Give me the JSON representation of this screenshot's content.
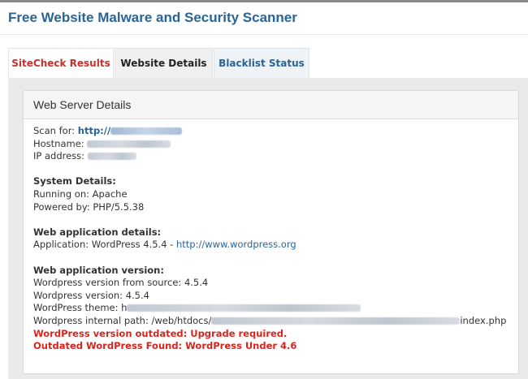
{
  "header": {
    "title": "Free Website Malware and Security Scanner"
  },
  "tabs": [
    {
      "label": "SiteCheck Results"
    },
    {
      "label": "Website Details"
    },
    {
      "label": "Blacklist Status"
    }
  ],
  "panel": {
    "title": "Web Server Details",
    "scan_for_label": "Scan for:",
    "scan_for_value": "http://",
    "hostname_label": "Hostname:",
    "ip_label": "IP address:",
    "system": {
      "heading": "System Details:",
      "running_on": "Running on: Apache",
      "powered_by": "Powered by: PHP/5.5.38"
    },
    "webapp": {
      "heading": "Web application details:",
      "application_text": "Application: WordPress 4.5.4 - ",
      "application_link": "http://www.wordpress.org"
    },
    "version": {
      "heading": "Web application version:",
      "from_source": "Wordpress version from source: 4.5.4",
      "version": "Wordpress version: 4.5.4",
      "theme_label": "WordPress theme: h",
      "internal_path_label": "Wordpress internal path: /web/htdocs/",
      "internal_path_end": "index.php",
      "warning_outdated": "WordPress version outdated: Upgrade required.",
      "warning_found": "Outdated WordPress Found: WordPress Under 4.6"
    }
  },
  "colors": {
    "title_blue": "#2a6496",
    "warning_red": "#d9251d",
    "active_tab_red": "#c9302c"
  }
}
